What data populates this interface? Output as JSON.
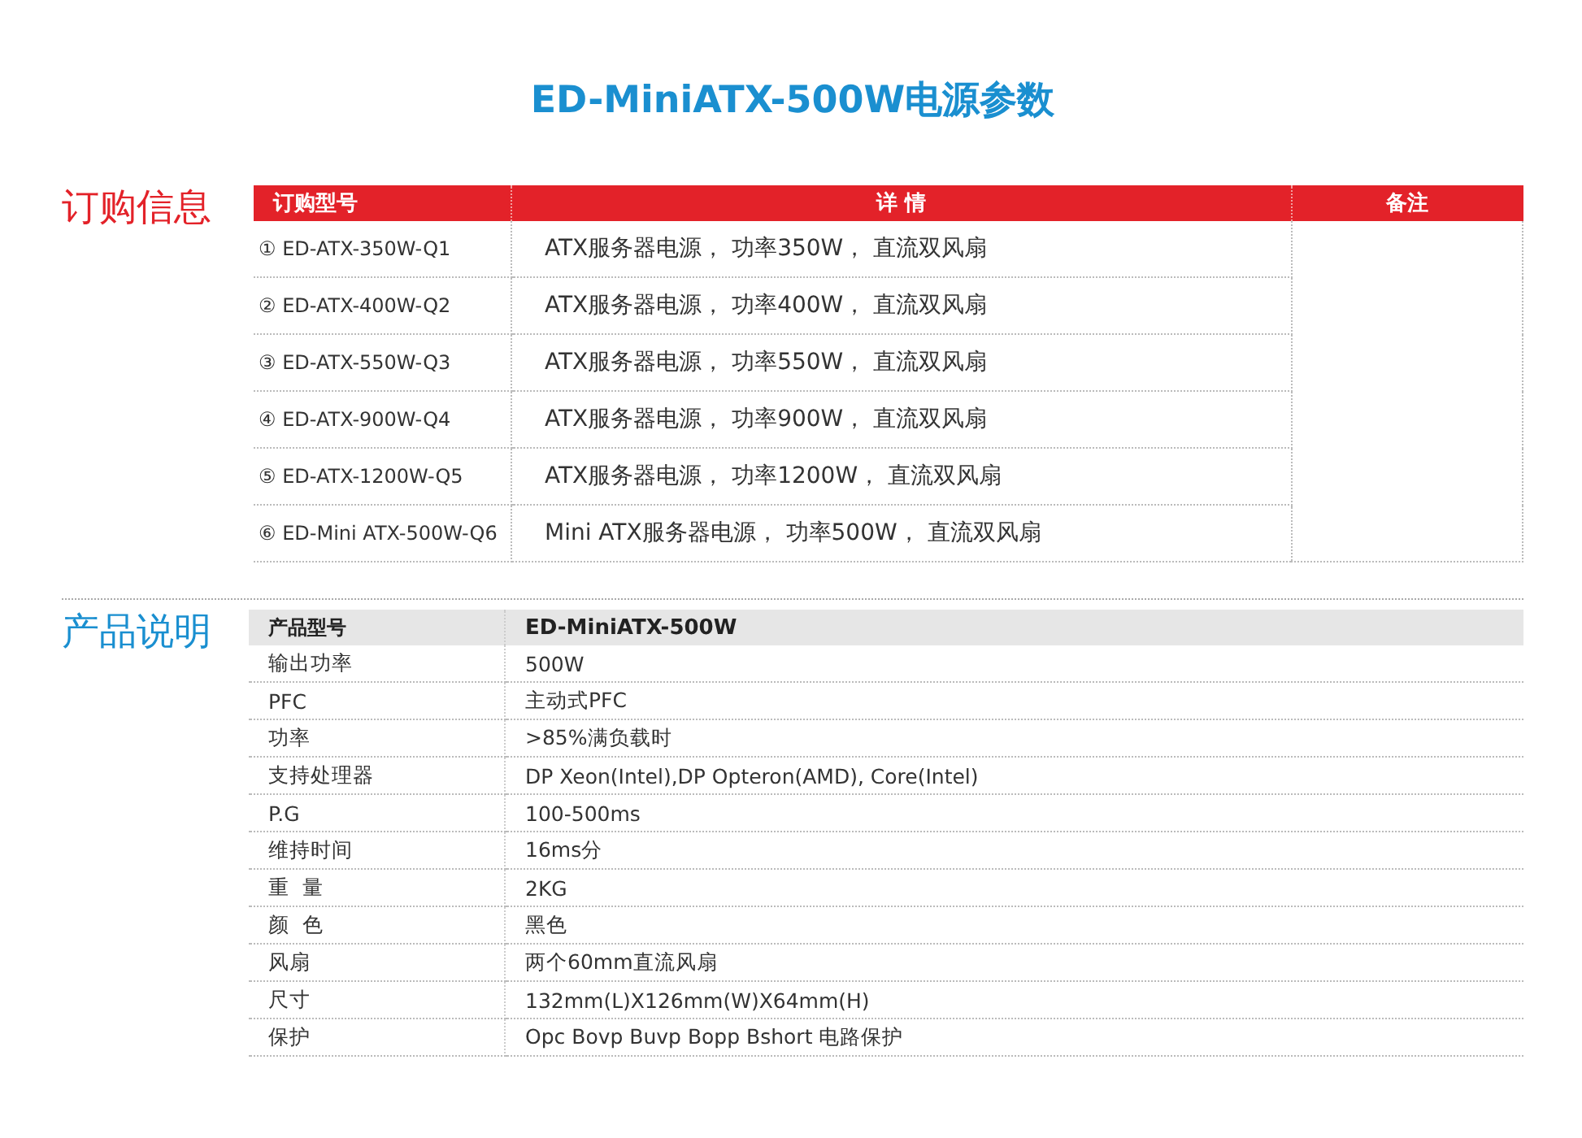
{
  "title": "ED-MiniATX-500W电源参数",
  "ordering": {
    "heading": "订购信息",
    "columns": [
      "订购型号",
      "详 情",
      "备注"
    ],
    "rows": [
      {
        "model": "① ED-ATX-350W-Q1",
        "detail": "ATX服务器电源， 功率350W， 直流双风扇"
      },
      {
        "model": "② ED-ATX-400W-Q2",
        "detail": "ATX服务器电源， 功率400W， 直流双风扇"
      },
      {
        "model": "③ ED-ATX-550W-Q3",
        "detail": "ATX服务器电源， 功率550W， 直流双风扇"
      },
      {
        "model": "④ ED-ATX-900W-Q4",
        "detail": "ATX服务器电源， 功率900W， 直流双风扇"
      },
      {
        "model": "⑤ ED-ATX-1200W-Q5",
        "detail": "ATX服务器电源， 功率1200W， 直流双风扇"
      },
      {
        "model": "⑥ ED-Mini ATX-500W-Q6",
        "detail": "Mini ATX服务器电源， 功率500W， 直流双风扇"
      }
    ]
  },
  "specs": {
    "heading": "产品说明",
    "header": {
      "label": "产品型号",
      "value": "ED-MiniATX-500W"
    },
    "rows": [
      {
        "label": "输出功率",
        "value": "500W"
      },
      {
        "label": "PFC",
        "value": "主动式PFC"
      },
      {
        "label": "功率",
        "value": ">85%满负载时"
      },
      {
        "label": "支持处理器",
        "value": "DP Xeon(Intel),DP Opteron(AMD), Core(Intel)"
      },
      {
        "label": "P.G",
        "value": "100-500ms"
      },
      {
        "label": "维持时间",
        "value": "16ms分"
      },
      {
        "label": "重  量",
        "value": "2KG"
      },
      {
        "label": "颜  色",
        "value": "黑色"
      },
      {
        "label": "风扇",
        "value": "两个60mm直流风扇"
      },
      {
        "label": "尺寸",
        "value": "132mm(L)X126mm(W)X64mm(H)"
      },
      {
        "label": "保护",
        "value": "Opc Bovp Buvp Bopp Bshort 电路保护"
      }
    ]
  }
}
